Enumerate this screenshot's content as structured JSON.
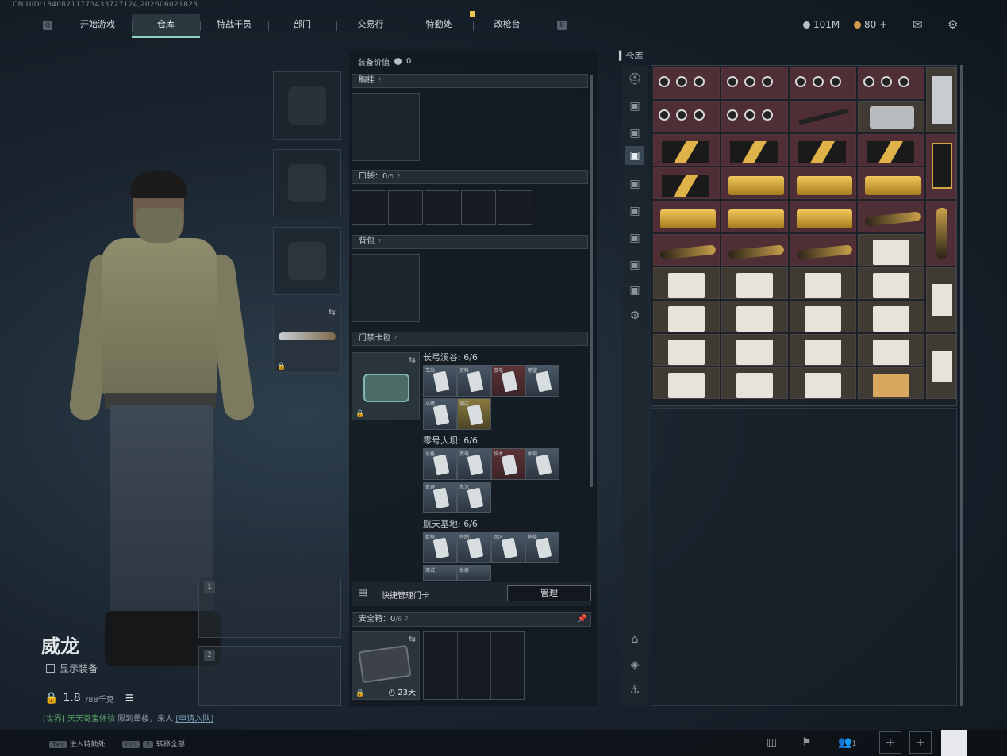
{
  "uid": "CN UID:184082117734337​27124,202606021823",
  "tabs": [
    {
      "label": "开始游戏"
    },
    {
      "label": "仓库"
    },
    {
      "label": "特战干员"
    },
    {
      "label": "部门"
    },
    {
      "label": "交易行"
    },
    {
      "label": "特勤处"
    },
    {
      "label": "改枪台"
    }
  ],
  "currency": {
    "silver": "101M",
    "gold": "80"
  },
  "character": {
    "name": "威龙",
    "show_equip_label": "显示装备",
    "weight_value": "1.8",
    "weight_max": "/88千克"
  },
  "chat": {
    "channel": "[世界]",
    "text": "天天哥宝体验",
    "mid": "限到晕楼，来人",
    "link": "[申请入队]"
  },
  "equip_value": {
    "label": "装备价值",
    "value": "0"
  },
  "sections": {
    "chest": "胸挂",
    "pocket_label": "口袋：",
    "pocket_value": "0",
    "pocket_max": "/5",
    "backpack": "背包",
    "keycard": "门禁卡包",
    "safe_label": "安全箱：",
    "safe_value": "0",
    "safe_max": "/6",
    "safe_time": "23天"
  },
  "keycard_groups": [
    {
      "title": "长弓溪谷: 6/6",
      "cards": [
        "车站",
        "资料",
        "变电",
        "瞭望",
        "小镇",
        "酒店"
      ]
    },
    {
      "title": "零号大坝: 6/6",
      "cards": [
        "设备",
        "变电",
        "技术",
        "水坝",
        "管理",
        "水泥"
      ]
    },
    {
      "title": "航天基地: 6/6",
      "cards": [
        "数据",
        "控制",
        "西区",
        "塔楼",
        "测试",
        "发射"
      ]
    }
  ],
  "manage": {
    "label": "快捷管理门卡",
    "button": "管理"
  },
  "warehouse": {
    "title": "仓库"
  },
  "bottom": {
    "tab_hint": "进入特勤处",
    "ctrl_hint": "转移全部",
    "friends": "1"
  }
}
